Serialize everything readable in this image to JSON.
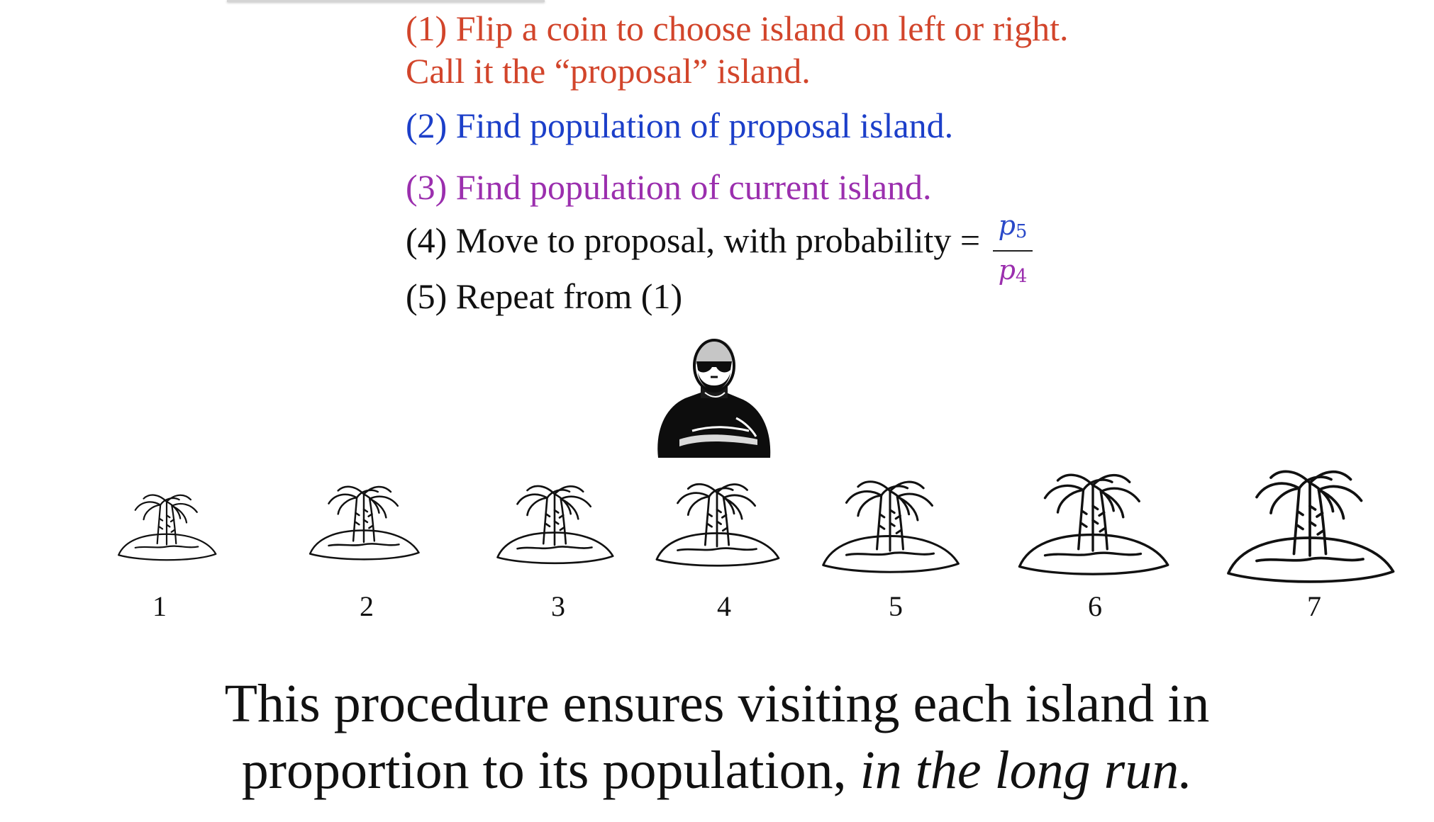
{
  "steps": {
    "step1_line1": "(1) Flip a coin to choose island on left or right.",
    "step1_line2": "Call it the “proposal” island.",
    "step2": "(2) Find population of proposal island.",
    "step3": "(3) Find population of current island.",
    "step4": "(4) Move to proposal, with probability =",
    "step5": "(5) Repeat from (1)"
  },
  "fraction": {
    "numerator_var": "p",
    "numerator_sub": "5",
    "denominator_var": "p",
    "denominator_sub": "4"
  },
  "islands": {
    "labels": [
      "1",
      "2",
      "3",
      "4",
      "5",
      "6",
      "7"
    ],
    "populations_relative": [
      1,
      2,
      3,
      4,
      5,
      6,
      7
    ]
  },
  "conclusion": {
    "line1": "This procedure ensures visiting each island in",
    "line2_plain": "proportion to its population, ",
    "line2_italic": "in the long run."
  },
  "colors": {
    "step1": "#d2452b",
    "step2": "#1c3fc9",
    "step3": "#9b2fae",
    "step4": "#111111",
    "step5": "#111111",
    "fraction_numerator": "#2a49c9",
    "fraction_denominator": "#9b2fae"
  },
  "icons": {
    "traveler": "king-figure-icon",
    "island": "palm-island-icon"
  }
}
